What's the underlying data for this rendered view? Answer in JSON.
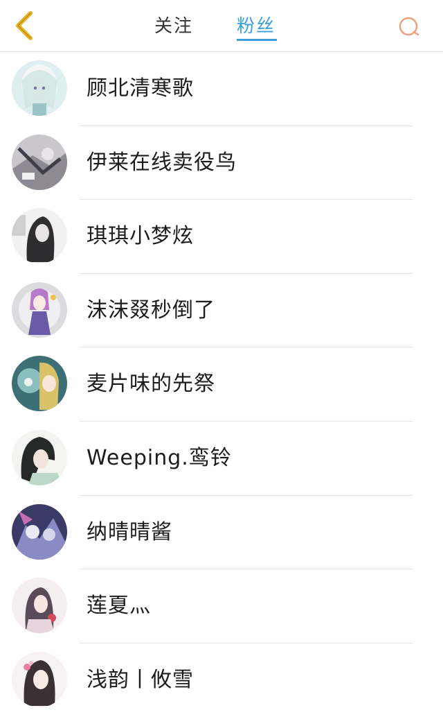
{
  "header": {
    "tabs": [
      {
        "label": "关注",
        "active": false
      },
      {
        "label": "粉丝",
        "active": true
      }
    ],
    "active_color": "#3aa0dc",
    "back_icon": "chevron-left-icon",
    "back_icon_color": "#e8b220",
    "search_icon": "search-icon",
    "search_icon_color": "#f0a080"
  },
  "fans": [
    {
      "name": "顾北清寒歌"
    },
    {
      "name": "伊莱在线卖役鸟"
    },
    {
      "name": "琪琪小梦炫"
    },
    {
      "name": "沫沫叕秒倒了"
    },
    {
      "name": "麦片味的先祭"
    },
    {
      "name": "Weeping.鸾铃"
    },
    {
      "name": "纳晴晴酱"
    },
    {
      "name": "莲夏灬"
    },
    {
      "name": "浅韵丨攸雪"
    }
  ]
}
